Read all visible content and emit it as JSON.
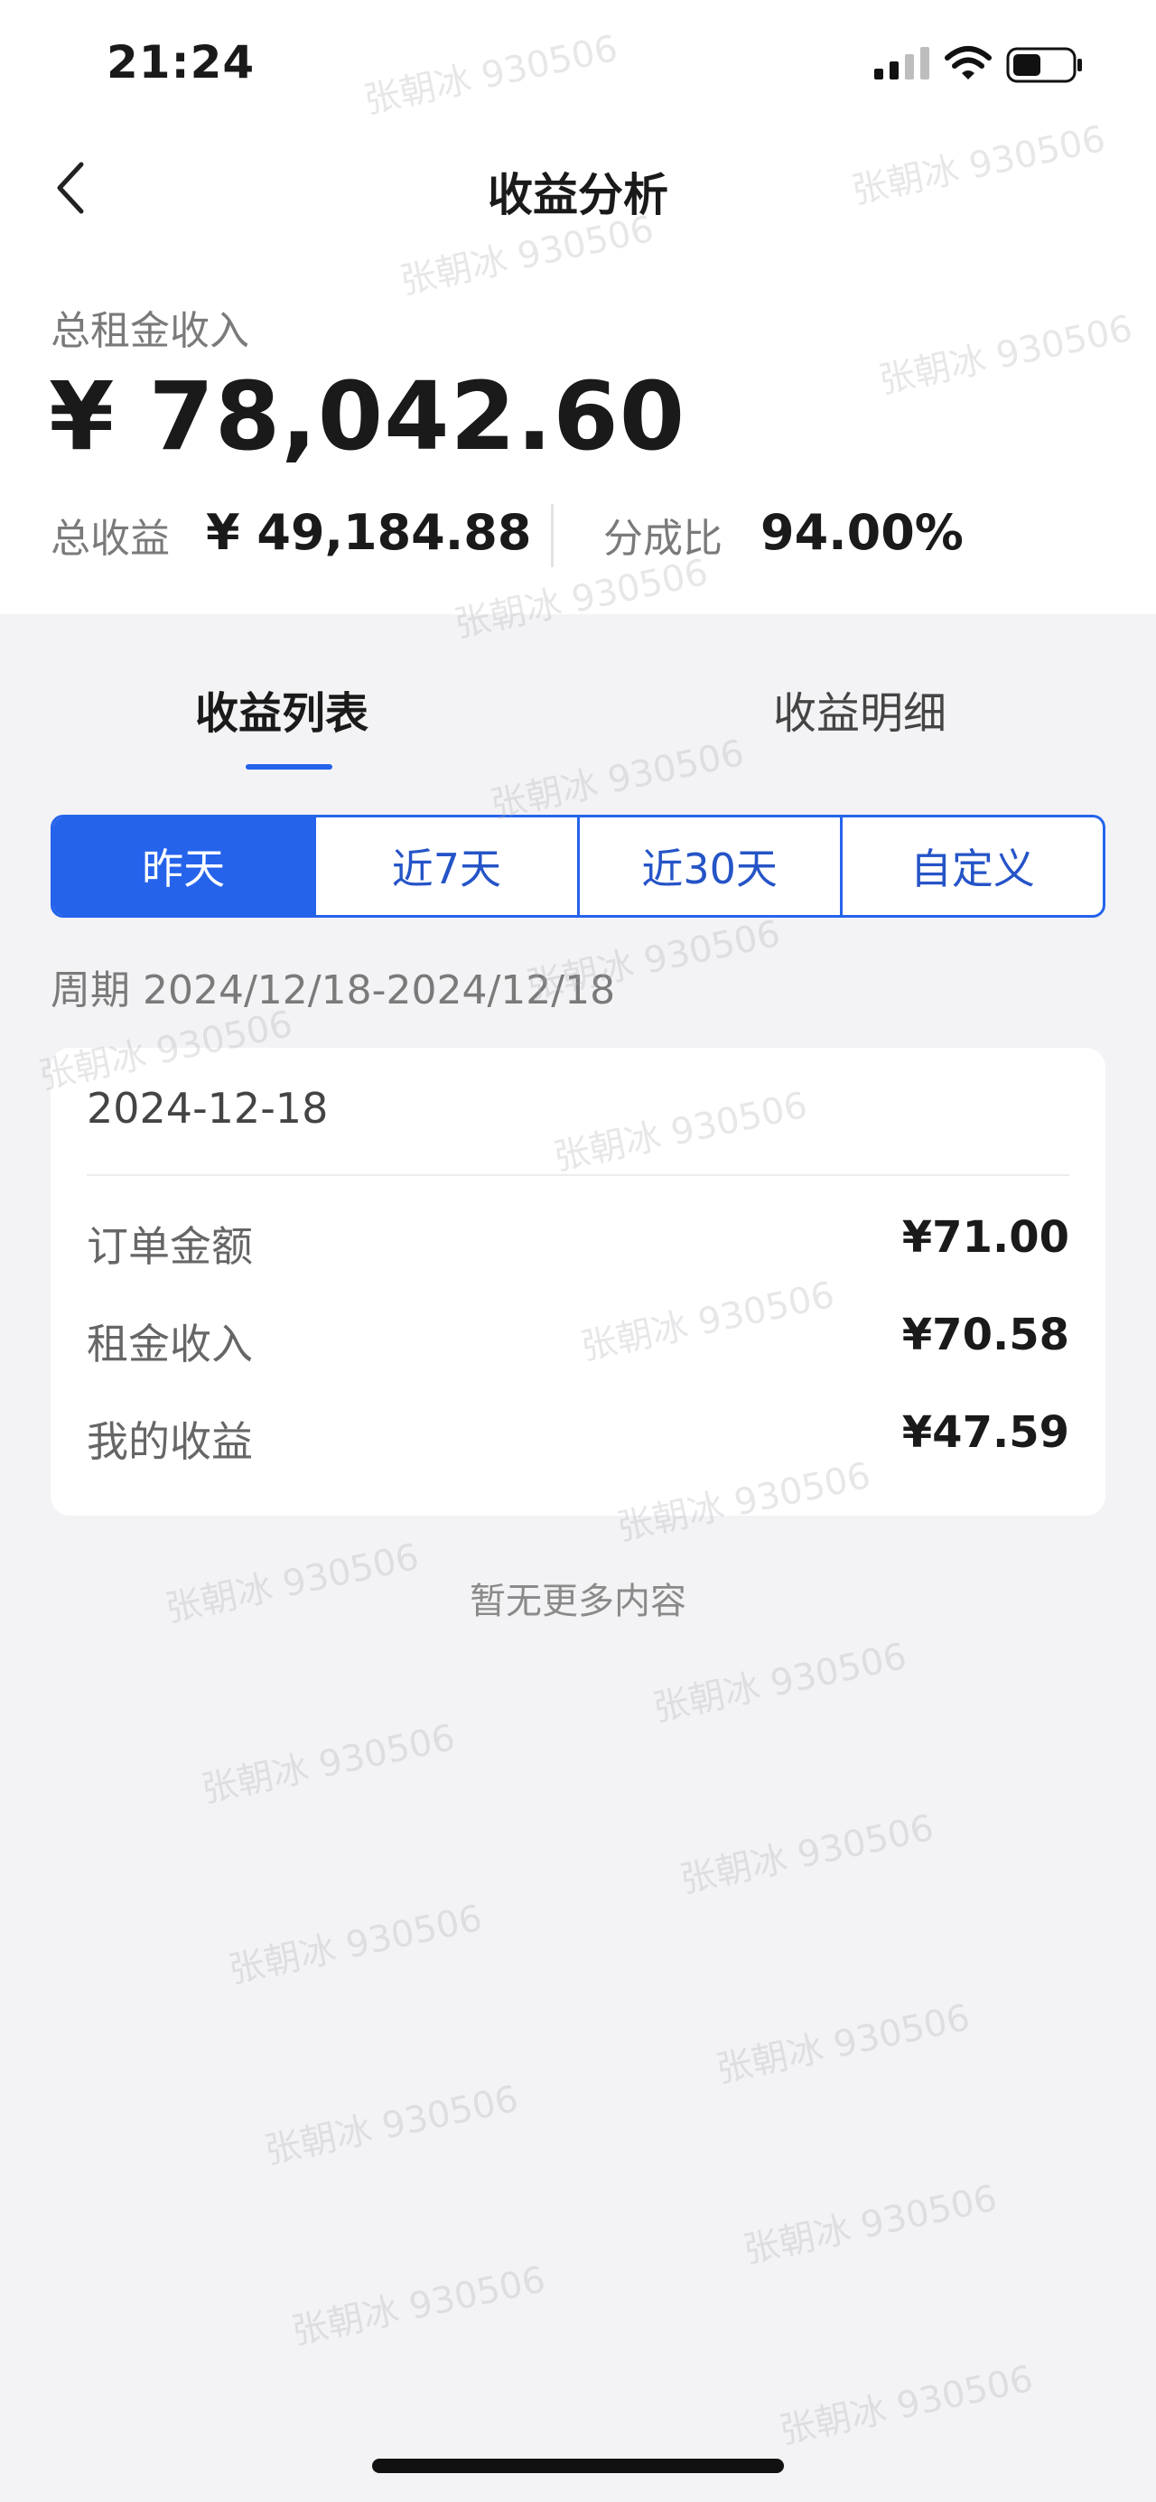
{
  "status_bar": {
    "time": "21:24"
  },
  "header": {
    "title": "收益分析"
  },
  "summary": {
    "total_rent_label": "总租金收入",
    "total_rent_value": "¥ 78,042.60",
    "total_income_label": "总收益",
    "total_income_value": "¥ 49,184.88",
    "share_ratio_label": "分成比",
    "share_ratio_value": "94.00%"
  },
  "tabs": [
    {
      "label": "收益列表",
      "active": true
    },
    {
      "label": "收益明细",
      "active": false
    }
  ],
  "ranges": [
    {
      "label": "昨天",
      "active": true
    },
    {
      "label": "近7天",
      "active": false
    },
    {
      "label": "近30天",
      "active": false
    },
    {
      "label": "自定义",
      "active": false
    }
  ],
  "period": "周期 2024/12/18-2024/12/18",
  "record": {
    "date": "2024-12-18",
    "rows": [
      {
        "label": "订单金额",
        "value": "¥71.00"
      },
      {
        "label": "租金收入",
        "value": "¥70.58"
      },
      {
        "label": "我的收益",
        "value": "¥47.59"
      }
    ]
  },
  "footer": {
    "no_more": "暂无更多内容"
  },
  "watermark": "张朝冰 930506",
  "colors": {
    "accent": "#2563eb",
    "background": "#f3f3f5"
  }
}
